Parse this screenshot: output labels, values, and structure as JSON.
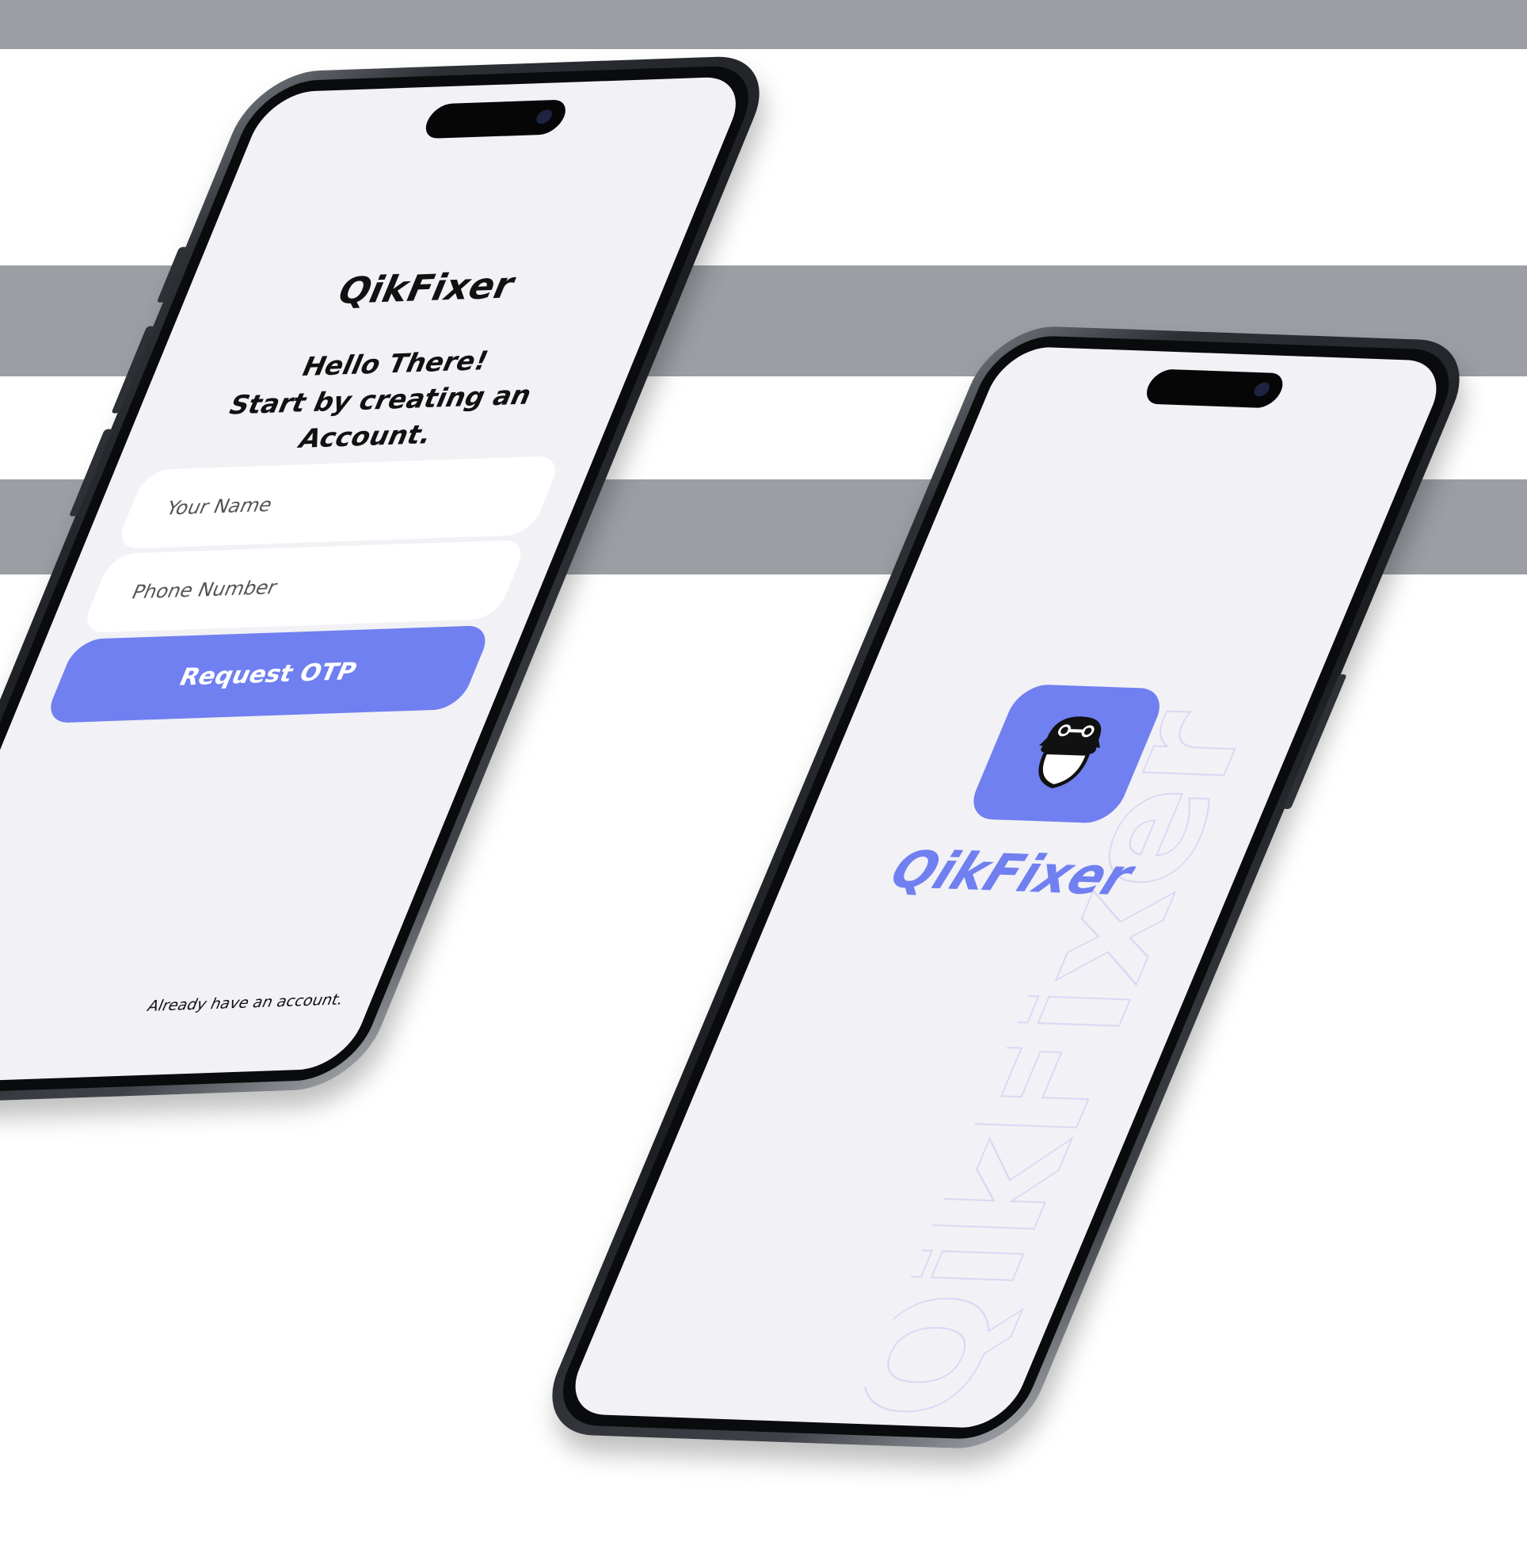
{
  "signup_screen": {
    "brand": "QikFixer",
    "greeting_line1": "Hello There!",
    "greeting_line2": "Start by creating an",
    "greeting_line3": "Account.",
    "name_placeholder": "Your Name",
    "phone_placeholder": "Phone Number",
    "request_otp_label": "Request OTP",
    "login_link_text": "Already have an account."
  },
  "splash_screen": {
    "app_title": "QikFixer",
    "watermark_text": "QikFixer",
    "logo_icon": "mechanic-cap-wrench-icon"
  },
  "colors": {
    "accent": "#7080f0",
    "screen_bg": "#f2f1f5",
    "band_gray": "#9b9fa4",
    "frame_dark": "#1b1d21"
  }
}
